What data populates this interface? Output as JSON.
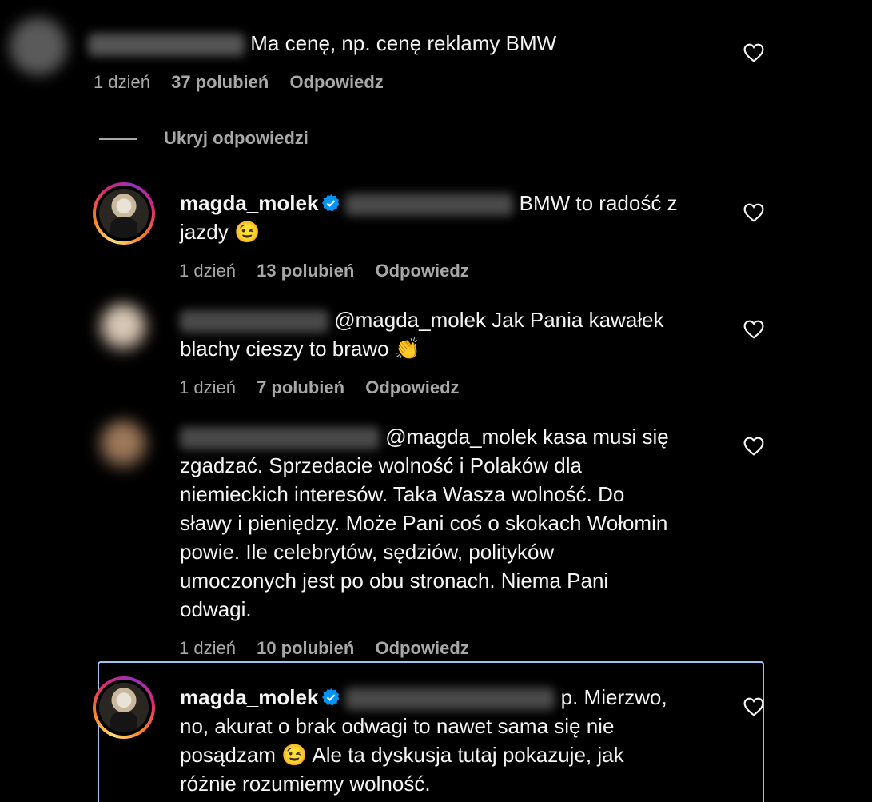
{
  "comments": [
    {
      "id": "c1",
      "text": "Ma cenę, np. cenę reklamy BMW",
      "time": "1 dzień",
      "likes": "37 polubień",
      "reply": "Odpowiedz"
    }
  ],
  "hide_replies": "Ukryj odpowiedzi",
  "replies": [
    {
      "username": "magda_molek",
      "text_line1": "BMW to radość z",
      "text_line2": "jazdy",
      "emoji": "😉",
      "time": "1 dzień",
      "likes": "13 polubień",
      "reply": "Odpowiedz"
    },
    {
      "mention": "@magda_molek",
      "text_line1": " Jak Pania kawałek",
      "text_line2": "blachy cieszy to brawo",
      "emoji": "👏",
      "time": "1 dzień",
      "likes": "7 polubień",
      "reply": "Odpowiedz"
    },
    {
      "mention": "@magda_molek",
      "text_line1": " kasa musi się",
      "lines": [
        "zgadzać. Sprzedacie wolność i Polaków dla",
        "niemieckich interesów. Taka Wasza wolność. Do",
        "sławy i pieniędzy. Może Pani coś o skokach Wołomin",
        "powie. Ile celebrytów, sędziów, polityków",
        "umoczonych jest po obu stronach. Niema Pani",
        "odwagi."
      ],
      "time": "1 dzień",
      "likes": "10 polubień",
      "reply": "Odpowiedz"
    },
    {
      "username": "magda_molek",
      "text_line1": "p. Mierzwo,",
      "lines": [
        "no, akurat o brak odwagi to nawet sama się nie"
      ],
      "line3_a": "posądzam",
      "emoji": "😉",
      "line3_b": " Ale ta dyskusja tutaj pokazuje, jak",
      "line4": "różnie rozumiemy wolność."
    }
  ],
  "colors": {
    "background": "#000000",
    "text": "#f5f5f5",
    "meta": "#a8a8a8",
    "verified": "#0095f6",
    "highlight": "#9dc4f3"
  },
  "icons": [
    "heart-icon",
    "verified-badge-icon"
  ]
}
